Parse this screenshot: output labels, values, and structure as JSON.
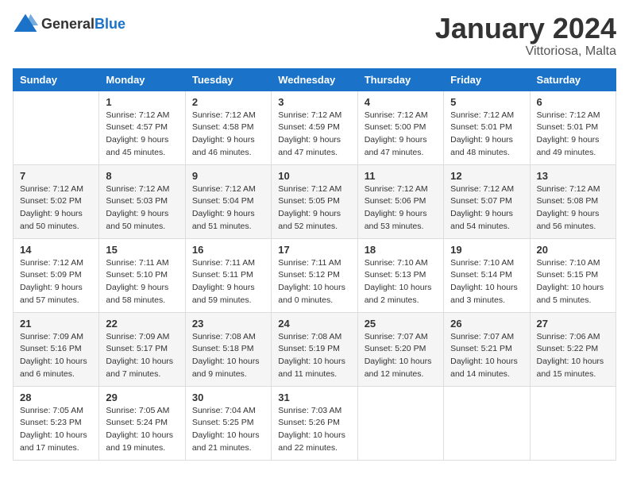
{
  "logo": {
    "general": "General",
    "blue": "Blue"
  },
  "title": "January 2024",
  "subtitle": "Vittoriosa, Malta",
  "days_of_week": [
    "Sunday",
    "Monday",
    "Tuesday",
    "Wednesday",
    "Thursday",
    "Friday",
    "Saturday"
  ],
  "weeks": [
    [
      {
        "day": "",
        "info": ""
      },
      {
        "day": "1",
        "info": "Sunrise: 7:12 AM\nSunset: 4:57 PM\nDaylight: 9 hours\nand 45 minutes."
      },
      {
        "day": "2",
        "info": "Sunrise: 7:12 AM\nSunset: 4:58 PM\nDaylight: 9 hours\nand 46 minutes."
      },
      {
        "day": "3",
        "info": "Sunrise: 7:12 AM\nSunset: 4:59 PM\nDaylight: 9 hours\nand 47 minutes."
      },
      {
        "day": "4",
        "info": "Sunrise: 7:12 AM\nSunset: 5:00 PM\nDaylight: 9 hours\nand 47 minutes."
      },
      {
        "day": "5",
        "info": "Sunrise: 7:12 AM\nSunset: 5:01 PM\nDaylight: 9 hours\nand 48 minutes."
      },
      {
        "day": "6",
        "info": "Sunrise: 7:12 AM\nSunset: 5:01 PM\nDaylight: 9 hours\nand 49 minutes."
      }
    ],
    [
      {
        "day": "7",
        "info": "Sunrise: 7:12 AM\nSunset: 5:02 PM\nDaylight: 9 hours\nand 50 minutes."
      },
      {
        "day": "8",
        "info": "Sunrise: 7:12 AM\nSunset: 5:03 PM\nDaylight: 9 hours\nand 50 minutes."
      },
      {
        "day": "9",
        "info": "Sunrise: 7:12 AM\nSunset: 5:04 PM\nDaylight: 9 hours\nand 51 minutes."
      },
      {
        "day": "10",
        "info": "Sunrise: 7:12 AM\nSunset: 5:05 PM\nDaylight: 9 hours\nand 52 minutes."
      },
      {
        "day": "11",
        "info": "Sunrise: 7:12 AM\nSunset: 5:06 PM\nDaylight: 9 hours\nand 53 minutes."
      },
      {
        "day": "12",
        "info": "Sunrise: 7:12 AM\nSunset: 5:07 PM\nDaylight: 9 hours\nand 54 minutes."
      },
      {
        "day": "13",
        "info": "Sunrise: 7:12 AM\nSunset: 5:08 PM\nDaylight: 9 hours\nand 56 minutes."
      }
    ],
    [
      {
        "day": "14",
        "info": "Sunrise: 7:12 AM\nSunset: 5:09 PM\nDaylight: 9 hours\nand 57 minutes."
      },
      {
        "day": "15",
        "info": "Sunrise: 7:11 AM\nSunset: 5:10 PM\nDaylight: 9 hours\nand 58 minutes."
      },
      {
        "day": "16",
        "info": "Sunrise: 7:11 AM\nSunset: 5:11 PM\nDaylight: 9 hours\nand 59 minutes."
      },
      {
        "day": "17",
        "info": "Sunrise: 7:11 AM\nSunset: 5:12 PM\nDaylight: 10 hours\nand 0 minutes."
      },
      {
        "day": "18",
        "info": "Sunrise: 7:10 AM\nSunset: 5:13 PM\nDaylight: 10 hours\nand 2 minutes."
      },
      {
        "day": "19",
        "info": "Sunrise: 7:10 AM\nSunset: 5:14 PM\nDaylight: 10 hours\nand 3 minutes."
      },
      {
        "day": "20",
        "info": "Sunrise: 7:10 AM\nSunset: 5:15 PM\nDaylight: 10 hours\nand 5 minutes."
      }
    ],
    [
      {
        "day": "21",
        "info": "Sunrise: 7:09 AM\nSunset: 5:16 PM\nDaylight: 10 hours\nand 6 minutes."
      },
      {
        "day": "22",
        "info": "Sunrise: 7:09 AM\nSunset: 5:17 PM\nDaylight: 10 hours\nand 7 minutes."
      },
      {
        "day": "23",
        "info": "Sunrise: 7:08 AM\nSunset: 5:18 PM\nDaylight: 10 hours\nand 9 minutes."
      },
      {
        "day": "24",
        "info": "Sunrise: 7:08 AM\nSunset: 5:19 PM\nDaylight: 10 hours\nand 11 minutes."
      },
      {
        "day": "25",
        "info": "Sunrise: 7:07 AM\nSunset: 5:20 PM\nDaylight: 10 hours\nand 12 minutes."
      },
      {
        "day": "26",
        "info": "Sunrise: 7:07 AM\nSunset: 5:21 PM\nDaylight: 10 hours\nand 14 minutes."
      },
      {
        "day": "27",
        "info": "Sunrise: 7:06 AM\nSunset: 5:22 PM\nDaylight: 10 hours\nand 15 minutes."
      }
    ],
    [
      {
        "day": "28",
        "info": "Sunrise: 7:05 AM\nSunset: 5:23 PM\nDaylight: 10 hours\nand 17 minutes."
      },
      {
        "day": "29",
        "info": "Sunrise: 7:05 AM\nSunset: 5:24 PM\nDaylight: 10 hours\nand 19 minutes."
      },
      {
        "day": "30",
        "info": "Sunrise: 7:04 AM\nSunset: 5:25 PM\nDaylight: 10 hours\nand 21 minutes."
      },
      {
        "day": "31",
        "info": "Sunrise: 7:03 AM\nSunset: 5:26 PM\nDaylight: 10 hours\nand 22 minutes."
      },
      {
        "day": "",
        "info": ""
      },
      {
        "day": "",
        "info": ""
      },
      {
        "day": "",
        "info": ""
      }
    ]
  ]
}
